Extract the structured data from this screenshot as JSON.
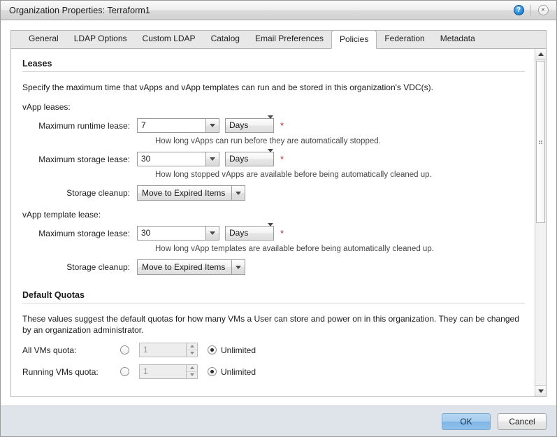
{
  "window": {
    "title": "Organization Properties: Terraform1",
    "help_icon": "help-icon",
    "help_glyph": "?",
    "close_icon": "close-icon",
    "close_glyph": "×"
  },
  "tabs": [
    {
      "label": "General",
      "active": false
    },
    {
      "label": "LDAP Options",
      "active": false
    },
    {
      "label": "Custom LDAP",
      "active": false
    },
    {
      "label": "Catalog",
      "active": false
    },
    {
      "label": "Email Preferences",
      "active": false
    },
    {
      "label": "Policies",
      "active": true
    },
    {
      "label": "Federation",
      "active": false
    },
    {
      "label": "Metadata",
      "active": false
    }
  ],
  "leases": {
    "section_title": "Leases",
    "description": "Specify the maximum time that vApps and vApp templates can run and be stored in this organization's VDC(s).",
    "vapp_group_label": "vApp leases:",
    "runtime_lease": {
      "label": "Maximum runtime lease:",
      "value": "7",
      "unit": "Days",
      "required_marker": "*",
      "hint": "How long vApps can run before they are automatically stopped."
    },
    "storage_lease": {
      "label": "Maximum storage lease:",
      "value": "30",
      "unit": "Days",
      "required_marker": "*",
      "hint": "How long stopped vApps are available before being automatically cleaned up."
    },
    "storage_cleanup": {
      "label": "Storage cleanup:",
      "value": "Move to Expired Items"
    },
    "template_group_label": "vApp template lease:",
    "template_storage_lease": {
      "label": "Maximum storage lease:",
      "value": "30",
      "unit": "Days",
      "required_marker": "*",
      "hint": "How long vApp templates are available before being automatically cleaned up."
    },
    "template_storage_cleanup": {
      "label": "Storage cleanup:",
      "value": "Move to Expired Items"
    }
  },
  "quotas": {
    "section_title": "Default Quotas",
    "description": "These values suggest the default quotas for how many VMs a User can store and power on in this organization. They can be changed by an organization administrator.",
    "rows": [
      {
        "label": "All VMs quota:",
        "value": "1",
        "value_selected": false,
        "unlimited_label": "Unlimited",
        "unlimited_selected": true
      },
      {
        "label": "Running VMs quota:",
        "value": "1",
        "value_selected": false,
        "unlimited_label": "Unlimited",
        "unlimited_selected": true
      }
    ]
  },
  "scrollbar": {
    "up_icon": "scroll-up-icon",
    "down_icon": "scroll-down-icon",
    "thumb": "scrollbar-thumb"
  },
  "footer": {
    "ok_label": "OK",
    "cancel_label": "Cancel"
  }
}
